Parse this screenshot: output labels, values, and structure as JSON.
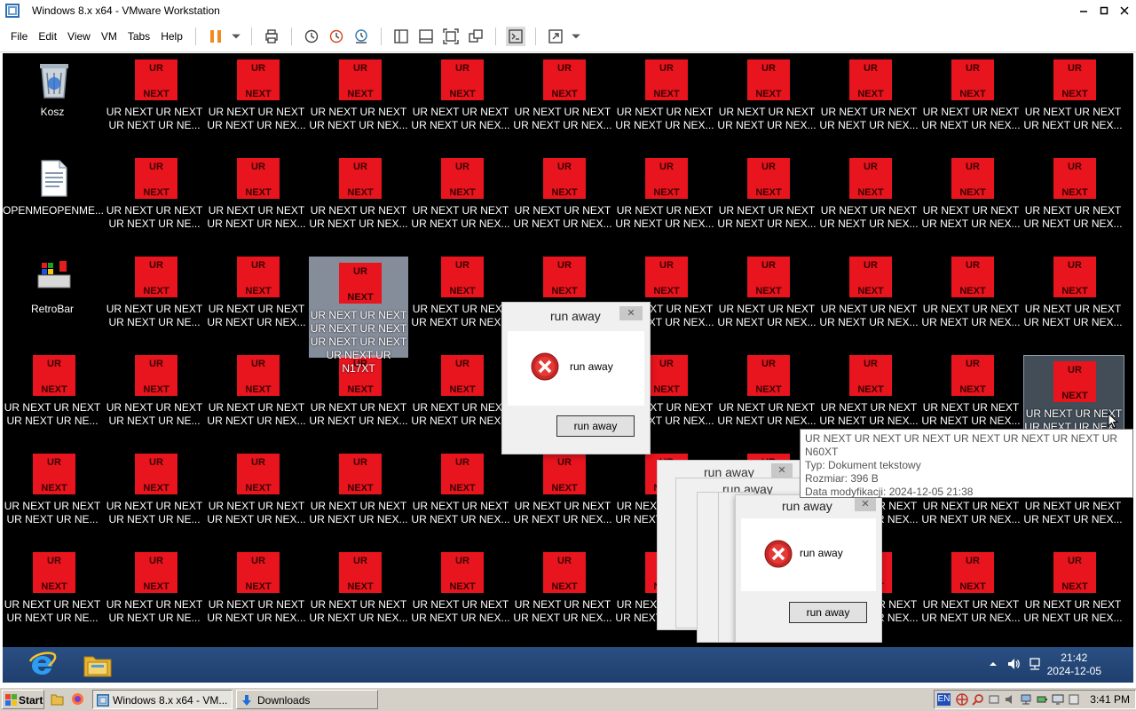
{
  "window": {
    "title": "Windows 8.x x64 - VMware Workstation"
  },
  "menu": [
    "File",
    "Edit",
    "View",
    "VM",
    "Tabs",
    "Help"
  ],
  "desktop": {
    "recycle_bin": "Kosz",
    "openme": "OPENMEOPENME...",
    "retrobar": "RetroBar",
    "icon_box_top": "UR",
    "icon_box_bottom": "NEXT",
    "icon_label_line1": "UR NEXT UR NEXT",
    "icon_label_line2_a": "UR NEXT UR NE...",
    "icon_label_line2_b": "UR NEXT UR NEX...",
    "selected_label": [
      "UR NEXT UR NEXT",
      "UR NEXT UR NEXT",
      "UR NEXT UR NEXT",
      "UR NEXT UR N17XT"
    ],
    "hover_label": [
      "UR NEXT UR NEXT",
      "UR NEXT UR NEX..."
    ],
    "partial_label_1": "UR NEX",
    "partial_label_2": "UR NEXT UR",
    "partial_label_3": "EXT UR NEXT",
    "partial_label_4": "XT UR NEXT",
    "partial_label_5": "NEXT"
  },
  "dialog": {
    "title": "run away",
    "message": "run away",
    "button": "run away"
  },
  "tooltip": {
    "line1": "UR NEXT UR NEXT UR NEXT UR NEXT UR NEXT UR NEXT UR",
    "line2": "N60XT",
    "line3": "Typ: Dokument tekstowy",
    "line4": "Rozmiar: 396 B",
    "line5": "Data modyfikacji: 2024-12-05 21:38"
  },
  "guest_taskbar": {
    "time": "21:42",
    "date": "2024-12-05"
  },
  "host_taskbar": {
    "start": "Start",
    "task1": "Windows 8.x x64 - VM...",
    "task2": "Downloads",
    "lang": "EN",
    "time": "3:41 PM"
  },
  "colors": {
    "ur_red": "#e8141e",
    "guest_taskbar": "#254a7c",
    "host_taskbar": "#d4d0c8"
  }
}
